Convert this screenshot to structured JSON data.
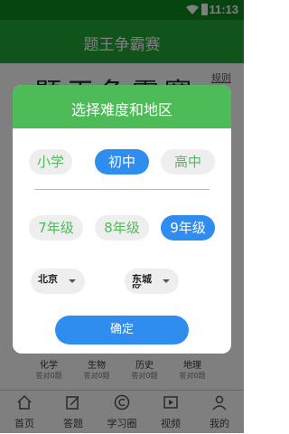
{
  "status_bar": {
    "time": "11:13"
  },
  "header": {
    "title": "题王争霸赛"
  },
  "background": {
    "big_title": "题王争霸赛",
    "rules_link": "规则",
    "categories": [
      {
        "name": "化学",
        "sub": "答对0题"
      },
      {
        "name": "生物",
        "sub": "答对0题"
      },
      {
        "name": "历史",
        "sub": "答对0题"
      },
      {
        "name": "地理",
        "sub": "答对0题"
      }
    ]
  },
  "tabs": [
    {
      "label": "首页",
      "icon": "home-icon"
    },
    {
      "label": "答题",
      "icon": "edit-icon"
    },
    {
      "label": "学习圈",
      "icon": "copyright-icon"
    },
    {
      "label": "视频",
      "icon": "video-icon"
    },
    {
      "label": "我的",
      "icon": "person-icon"
    }
  ],
  "dialog": {
    "title": "选择难度和地区",
    "levels": [
      "小学",
      "初中",
      "高中"
    ],
    "selected_level": "初中",
    "grades": [
      "7年级",
      "8年级",
      "9年级"
    ],
    "selected_grade": "9年级",
    "city": "北京",
    "district": "东城区",
    "confirm_label": "确定"
  },
  "colors": {
    "primary_green": "#22a836",
    "dialog_green": "#4cbb58",
    "accent_blue": "#2f8df0"
  }
}
